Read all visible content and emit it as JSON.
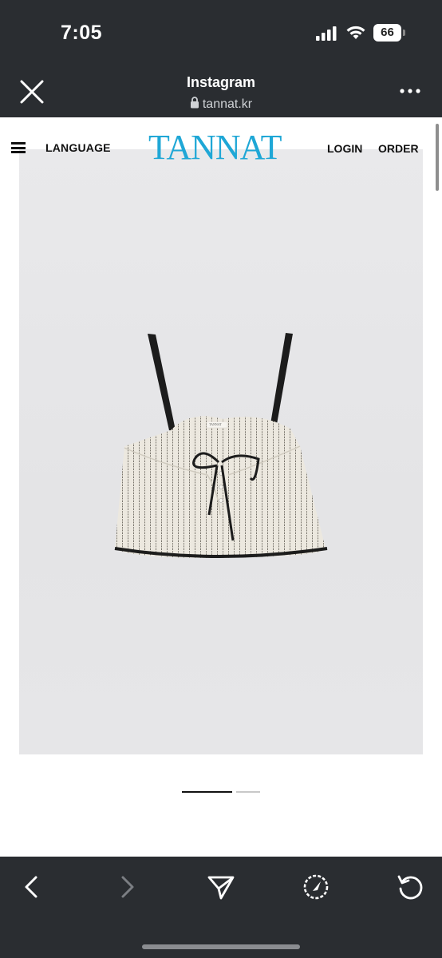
{
  "status_bar": {
    "time": "7:05",
    "battery_level": "66",
    "icons": [
      "signal-icon",
      "wifi-icon",
      "battery-icon"
    ]
  },
  "browser_header": {
    "title": "Instagram",
    "url": "tannat.kr",
    "icons": [
      "close-icon",
      "lock-icon",
      "more-icon"
    ]
  },
  "site": {
    "logo": "TANNAT",
    "nav": {
      "language": "LANGUAGE",
      "login": "LOGIN",
      "order": "ORDER"
    },
    "product_image": {
      "label_tag": "TANNAT",
      "description_icon": "striped-camisole-top-image"
    },
    "carousel": {
      "total": 2,
      "active_index": 1
    }
  },
  "toolbar": {
    "icons": [
      "back-icon",
      "forward-icon",
      "share-icon",
      "safari-compass-icon",
      "reload-icon"
    ],
    "forward_enabled": false
  },
  "colors": {
    "chrome_bg": "#2a2d31",
    "logo": "#1fa7d6",
    "page_bg": "#ffffff",
    "image_bg": "#e7e7e9"
  }
}
